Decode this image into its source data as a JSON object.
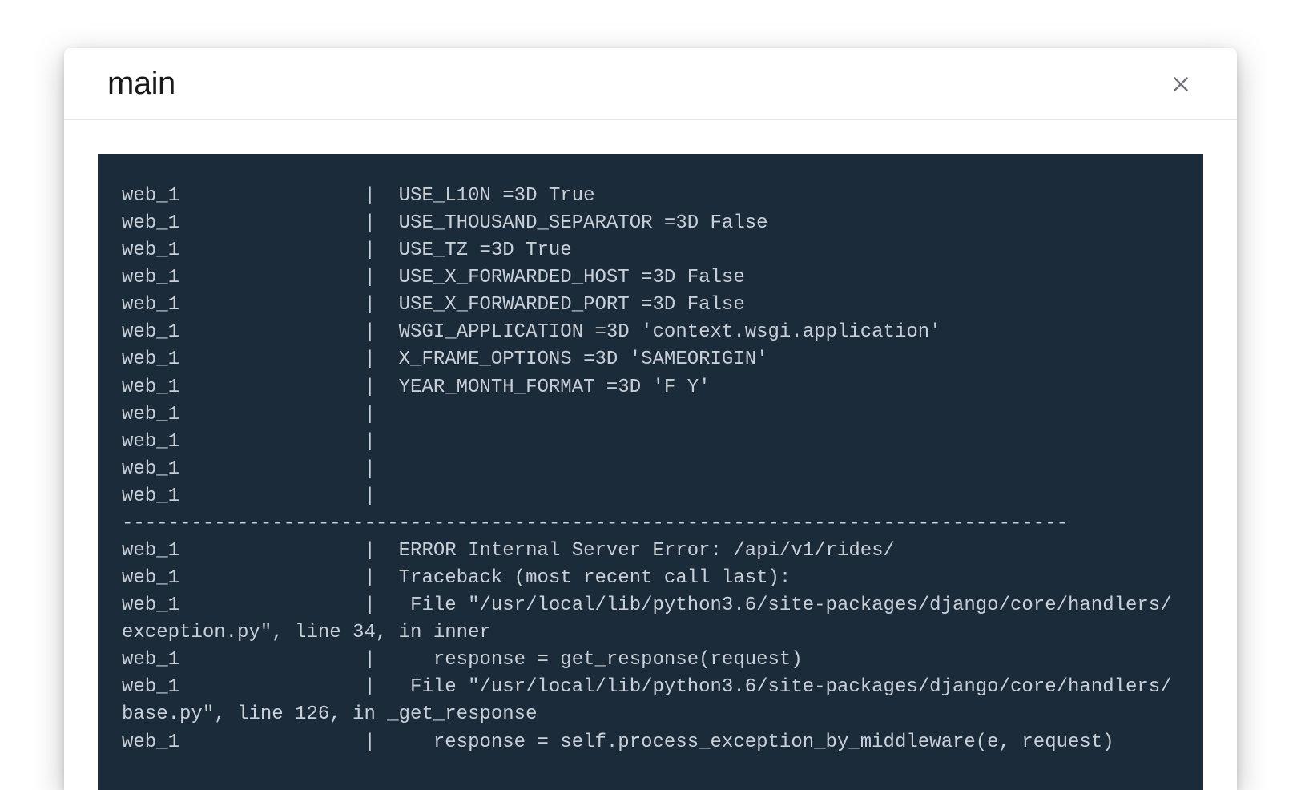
{
  "header": {
    "title": "main"
  },
  "terminal": {
    "text": "web_1                |  USE_L10N =3D True\nweb_1                |  USE_THOUSAND_SEPARATOR =3D False\nweb_1                |  USE_TZ =3D True\nweb_1                |  USE_X_FORWARDED_HOST =3D False\nweb_1                |  USE_X_FORWARDED_PORT =3D False\nweb_1                |  WSGI_APPLICATION =3D 'context.wsgi.application'\nweb_1                |  X_FRAME_OPTIONS =3D 'SAMEORIGIN'\nweb_1                |  YEAR_MONTH_FORMAT =3D 'F Y'\nweb_1                |\nweb_1                |\nweb_1                |\nweb_1                |\n----------------------------------------------------------------------------------\nweb_1                |  ERROR Internal Server Error: /api/v1/rides/\nweb_1                |  Traceback (most recent call last):\nweb_1                |   File \"/usr/local/lib/python3.6/site-packages/django/core/handlers/exception.py\", line 34, in inner\nweb_1                |     response = get_response(request)\nweb_1                |   File \"/usr/local/lib/python3.6/site-packages/django/core/handlers/base.py\", line 126, in _get_response\nweb_1                |     response = self.process_exception_by_middleware(e, request)"
  }
}
